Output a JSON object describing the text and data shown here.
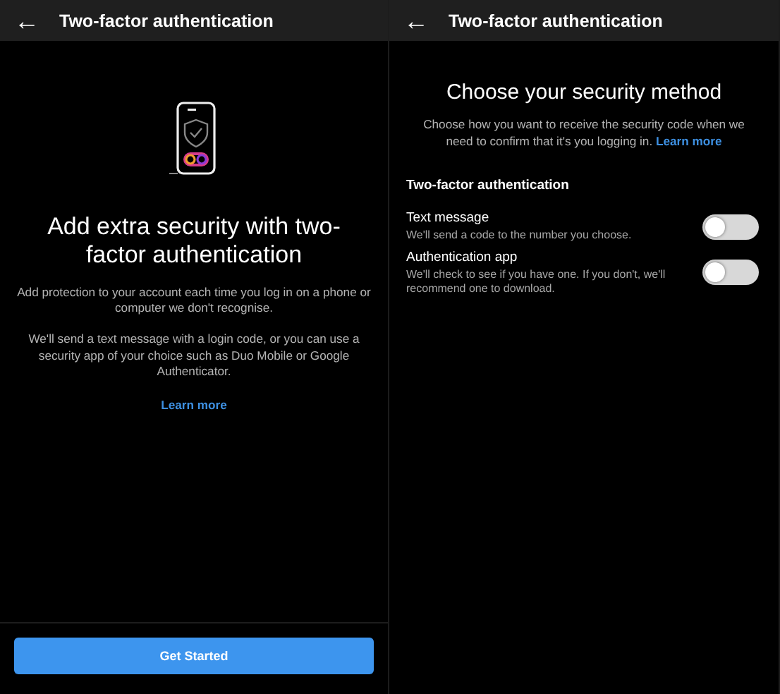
{
  "screens": [
    {
      "kind": "intro",
      "title": "Two-factor authentication",
      "back": "←",
      "heading": "Add extra security with two-factor authentication",
      "paragraphs": [
        "Add protection to your account each time you log in on a phone or computer we don't recognise.",
        "We'll send a text message with a login code, or you can use a security app of your choice such as Duo Mobile or Google Authenticator."
      ],
      "link": "Learn more",
      "button": "Get Started"
    },
    {
      "kind": "methods",
      "title": "Two-factor authentication",
      "back": "←",
      "heading": "Choose your security method",
      "description": "Choose how you want to receive the security code when we need to confirm that it's you logging in.",
      "link": "Learn more",
      "section": "Two-factor authentication",
      "options": [
        {
          "label": "Text message",
          "detail": "We'll send a code to the number you choose.",
          "on": false
        },
        {
          "label": "Authentication app",
          "detail": "We'll check to see if you have one. If you don't, we'll recommend one to download.",
          "on": false
        }
      ]
    }
  ]
}
